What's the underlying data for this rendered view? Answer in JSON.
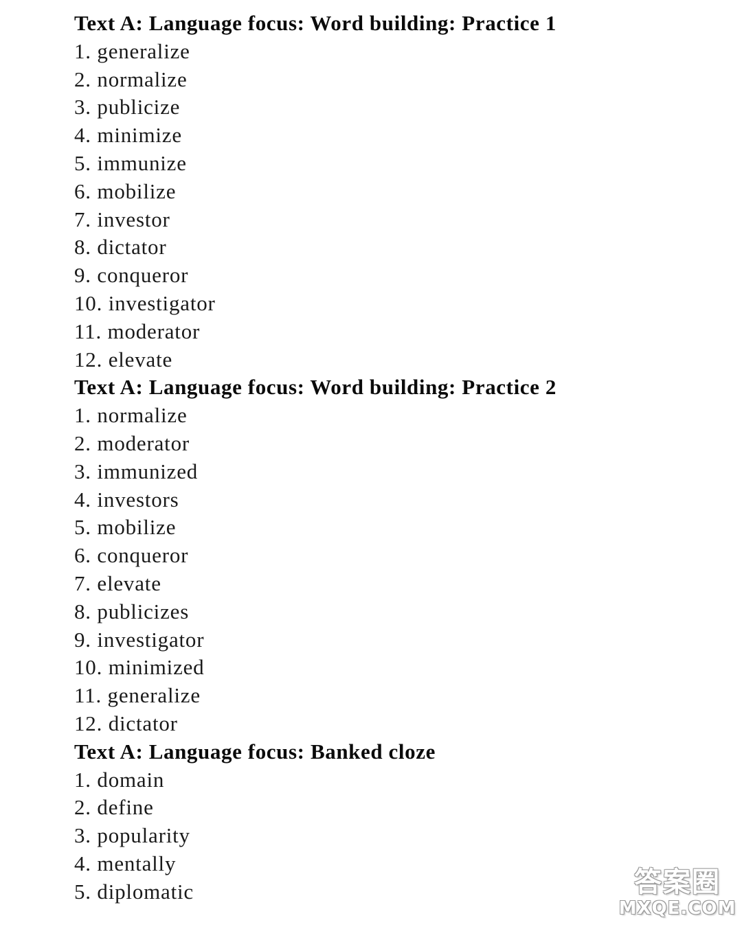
{
  "sections": [
    {
      "heading": "Text A: Language focus: Word building: Practice 1",
      "items": [
        "1. generalize",
        "2. normalize",
        "3. publicize",
        "4. minimize",
        "5. immunize",
        "6. mobilize",
        "7. investor",
        "8. dictator",
        "9. conqueror",
        "10. investigator",
        "11. moderator",
        "12. elevate"
      ]
    },
    {
      "heading": "Text A: Language focus: Word building: Practice 2",
      "items": [
        "1. normalize",
        "2. moderator",
        "3. immunized",
        "4. investors",
        "5. mobilize",
        "6. conqueror",
        "7. elevate",
        "8. publicizes",
        "9. investigator",
        "10. minimized",
        "11. generalize",
        "12. dictator"
      ]
    },
    {
      "heading": "Text A: Language focus: Banked cloze",
      "items": [
        "1. domain",
        "2. define",
        "3. popularity",
        "4. mentally",
        "5. diplomatic"
      ]
    }
  ],
  "watermark": {
    "chinese": "答案圈",
    "domain": "MXQE.COM"
  }
}
